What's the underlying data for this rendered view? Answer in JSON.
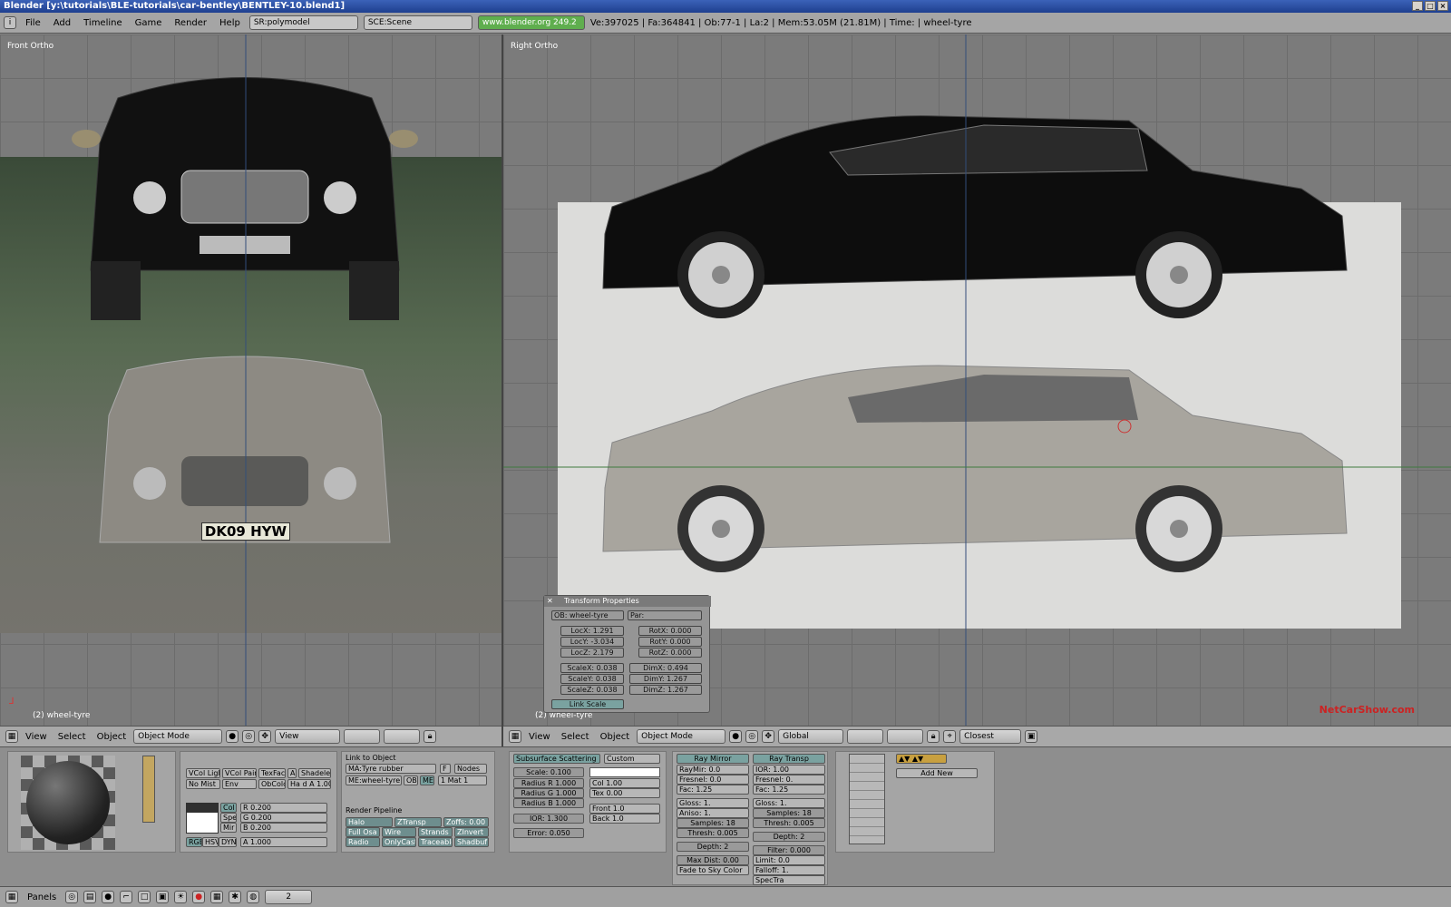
{
  "window": {
    "title": "Blender [y:\\tutorials\\BLE-tutorials\\car-bentley\\BENTLEY-10.blend1]"
  },
  "info": {
    "menus": [
      "File",
      "Add",
      "Timeline",
      "Game",
      "Render",
      "Help"
    ],
    "screen": "SR:polymodel",
    "scene": "SCE:Scene",
    "url": "www.blender.org 249.2",
    "stats": "Ve:397025 | Fa:364841 | Ob:77-1 | La:2 | Mem:53.05M (21.81M) | Time: | wheel-tyre"
  },
  "left_view": {
    "label": "Front Ortho",
    "object": "(2) wheel-tyre",
    "plate": "DK09 HYW"
  },
  "right_view": {
    "label": "Right Ortho",
    "object": "(2) wheel-tyre",
    "watermark": "NetCarShow.com"
  },
  "header3d": {
    "view": "View",
    "select": "Select",
    "object": "Object",
    "mode": "Object Mode",
    "view_dd": "View",
    "global": "Global",
    "snap": "Closest"
  },
  "transform": {
    "title": "Transform Properties",
    "ob": "OB: wheel-tyre",
    "par": "Par:",
    "locx": "LocX: 1.291",
    "locy": "LocY: -3.034",
    "locz": "LocZ: 2.179",
    "rotx": "RotX: 0.000",
    "roty": "RotY: 0.000",
    "rotz": "RotZ: 0.000",
    "scalex": "ScaleX: 0.038",
    "scaley": "ScaleY: 0.038",
    "scalez": "ScaleZ: 0.038",
    "dimx": "DimX: 0.494",
    "dimy": "DimY: 1.267",
    "dimz": "DimZ: 1.267",
    "link_scale": "Link Scale"
  },
  "material": {
    "vcol_light": "VCol Ligh",
    "vcol_paint": "VCol Pain",
    "texface": "TexFace",
    "a": "A",
    "shadeless": "Shadeles",
    "no_mist": "No Mist",
    "env": "Env",
    "obcolor": "ObColo",
    "halo_a": "Ha d A 1.00",
    "col": "Col",
    "spe": "Spe",
    "mir": "Mir",
    "r": "R 0.200",
    "g": "G 0.200",
    "b": "B 0.200",
    "rgb": "RGB",
    "hsv": "HSV",
    "dyn": "DYN",
    "alpha": "A 1.000",
    "link_to_object": "Link to Object",
    "ma": "MA:Tyre rubber",
    "f": "F",
    "nodes": "Nodes",
    "me": "ME:wheel-tyre",
    "ob": "OB",
    "me_btn": "ME",
    "mat": "1 Mat 1",
    "render_pipeline": "Render Pipeline",
    "halo": "Halo",
    "ztransp": "ZTransp",
    "zoffs": "Zoffs: 0.00",
    "full_osa": "Full Osa",
    "wire": "Wire",
    "strands": "Strands",
    "zinvert": "ZInvert",
    "radio": "Radio",
    "onlycast": "OnlyCast",
    "traceable": "Traceable",
    "shadbuf": "Shadbuf"
  },
  "sss": {
    "title": "Subsurface Scattering",
    "preset": "Custom",
    "scale": "Scale: 0.100",
    "rad_r": "Radius R 1.000",
    "rad_g": "Radius G 1.000",
    "rad_b": "Radius B 1.000",
    "ior": "IOR: 1.300",
    "error": "Error: 0.050",
    "col": "Col 1.00",
    "tex": "Tex 0.00",
    "front": "Front 1.0",
    "back": "Back 1.0"
  },
  "mirror": {
    "title": "Ray Mirror",
    "raymir": "RayMir: 0.0",
    "fresnel": "Fresnel: 0.0",
    "fac": "Fac: 1.25",
    "gloss": "Gloss: 1.",
    "aniso": "Aniso: 1.",
    "samples": "Samples: 18",
    "thresh": "Thresh: 0.005",
    "depth": "Depth: 2",
    "maxdist": "Max Dist: 0.00",
    "fade": "Fade to Sky Color"
  },
  "transp": {
    "title": "Ray Transp",
    "ior": "IOR: 1.00",
    "fresnel": "Fresnel: 0.",
    "fac": "Fac: 1.25",
    "gloss": "Gloss: 1.",
    "samples": "Samples: 18",
    "thresh": "Thresh: 0.005",
    "depth": "Depth: 2",
    "filter": "Filter: 0.000",
    "limit": "Limit: 0.0",
    "falloff": "Falloff: 1.",
    "spectra": "SpecTra"
  },
  "texture": {
    "add_new": "Add New"
  },
  "status": {
    "panels": "Panels",
    "frame": "2"
  }
}
